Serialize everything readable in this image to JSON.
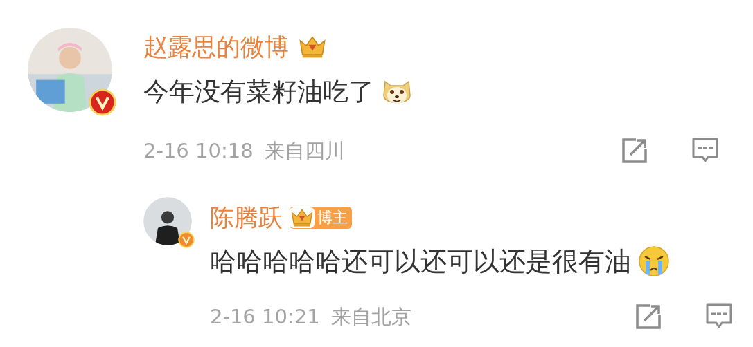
{
  "comments": [
    {
      "author": "赵露思的微博",
      "badge": {
        "kind": "crown"
      },
      "verified": {
        "color": "#d9261c"
      },
      "avatar": {
        "kind": "large"
      },
      "text": "今年没有菜籽油吃了",
      "emoji": {
        "kind": "doge"
      },
      "time": "2-16 10:18",
      "location": "来自四川",
      "replies": [
        {
          "author": "陈腾跃",
          "badge": {
            "kind": "crown_label",
            "label": "博主"
          },
          "verified": {
            "color": "#f08a2c"
          },
          "avatar": {
            "kind": "small"
          },
          "text": "哈哈哈哈哈还可以还可以还是很有油",
          "emoji": {
            "kind": "cry"
          },
          "time": "2-16 10:21",
          "location": "来自北京"
        }
      ]
    }
  ]
}
